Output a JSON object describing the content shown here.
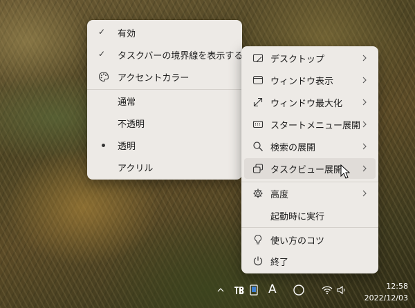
{
  "left_menu": {
    "items": [
      {
        "label": "有効",
        "checked": true
      },
      {
        "label": "タスクバーの境界線を表示する",
        "checked": true
      },
      {
        "label": "アクセントカラー",
        "icon": "palette-icon"
      }
    ],
    "transparency_options": [
      {
        "label": "通常"
      },
      {
        "label": "不透明"
      },
      {
        "label": "透明",
        "selected": true
      },
      {
        "label": "アクリル"
      }
    ]
  },
  "right_menu": {
    "items": [
      {
        "label": "デスクトップ",
        "icon": "desktop-icon",
        "submenu": true
      },
      {
        "label": "ウィンドウ表示",
        "icon": "window-icon",
        "submenu": true
      },
      {
        "label": "ウィンドウ最大化",
        "icon": "maximize-arrow-icon",
        "submenu": true
      },
      {
        "label": "スタートメニュー展開",
        "icon": "keyboard-icon",
        "submenu": true
      },
      {
        "label": "検索の展開",
        "icon": "search-icon",
        "submenu": true
      },
      {
        "label": "タスクビュー展開",
        "icon": "task-view-icon",
        "submenu": true,
        "hovered": true
      },
      {
        "label": "高度",
        "icon": "gear-icon",
        "submenu": true
      },
      {
        "label": "起動時に実行"
      },
      {
        "label": "使い方のコツ",
        "icon": "lightbulb-icon"
      },
      {
        "label": "終了",
        "icon": "power-icon"
      }
    ]
  },
  "taskbar": {
    "tray_icons": [
      "chevron-up-icon",
      "taskbar-app-icon",
      "tablet-icon",
      "font-icon",
      "moon-icon",
      "wifi-icon",
      "volume-icon"
    ],
    "font_icon_glyph": "A",
    "time": "12:58",
    "date": "2022/12/03"
  }
}
